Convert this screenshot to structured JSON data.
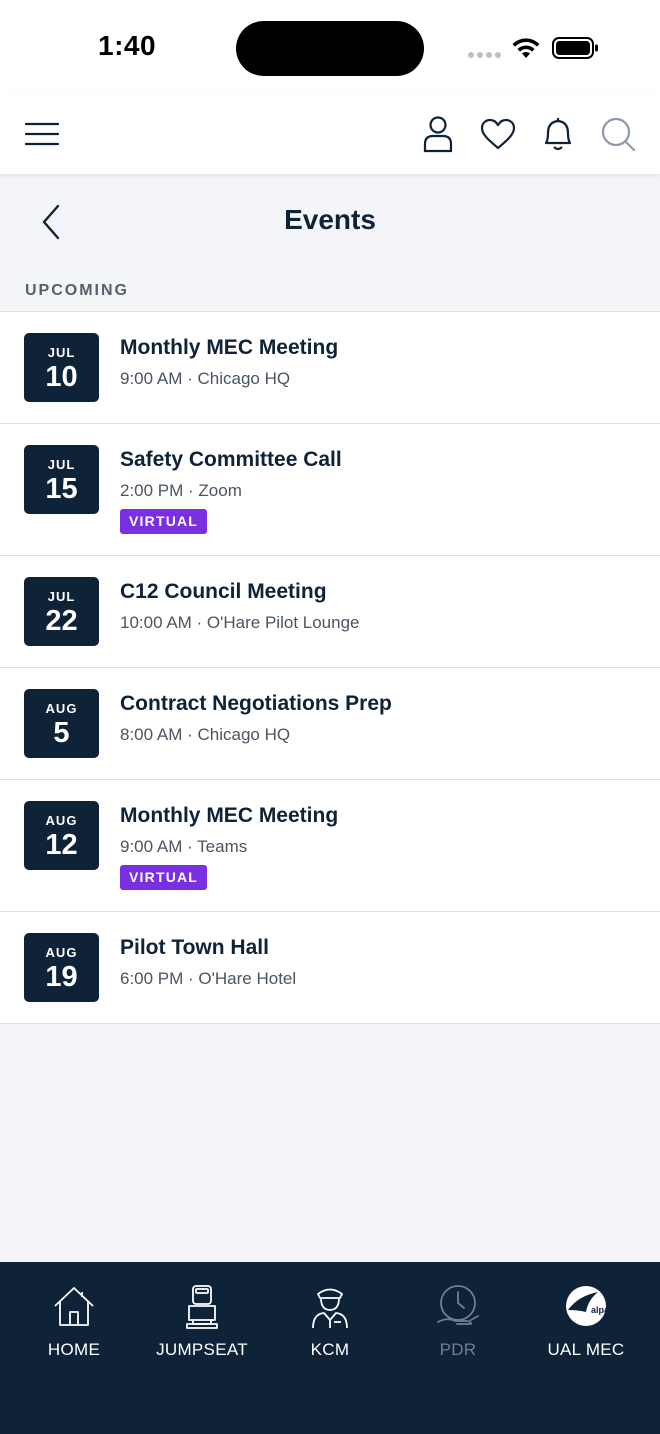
{
  "status_bar": {
    "time": "1:40"
  },
  "header": {
    "title": "Events"
  },
  "section": {
    "label": "UPCOMING"
  },
  "events": [
    {
      "month": "JUL",
      "day": "10",
      "title": "Monthly MEC Meeting",
      "meta": "9:00 AM · Chicago HQ",
      "badge": ""
    },
    {
      "month": "JUL",
      "day": "15",
      "title": "Safety Committee Call",
      "meta": "2:00 PM · Zoom",
      "badge": "VIRTUAL"
    },
    {
      "month": "JUL",
      "day": "22",
      "title": "C12 Council Meeting",
      "meta": "10:00 AM · O'Hare Pilot Lounge",
      "badge": ""
    },
    {
      "month": "AUG",
      "day": "5",
      "title": "Contract Negotiations Prep",
      "meta": "8:00 AM · Chicago HQ",
      "badge": ""
    },
    {
      "month": "AUG",
      "day": "12",
      "title": "Monthly MEC Meeting",
      "meta": "9:00 AM · Teams",
      "badge": "VIRTUAL"
    },
    {
      "month": "AUG",
      "day": "19",
      "title": "Pilot Town Hall",
      "meta": "6:00 PM · O'Hare Hotel",
      "badge": ""
    }
  ],
  "tabs": [
    {
      "label": "HOME",
      "icon": "home-icon"
    },
    {
      "label": "JUMPSEAT",
      "icon": "jumpseat-icon"
    },
    {
      "label": "KCM",
      "icon": "pilot-icon"
    },
    {
      "label": "PDR",
      "icon": "clock-hand-icon",
      "disabled": true
    },
    {
      "label": "UAL MEC",
      "icon": "alpa-logo-icon"
    }
  ],
  "logo_text": "alpa",
  "colors": {
    "navy": "#0e2238",
    "virtual": "#7a2fe0",
    "background": "#f3f5f9"
  }
}
